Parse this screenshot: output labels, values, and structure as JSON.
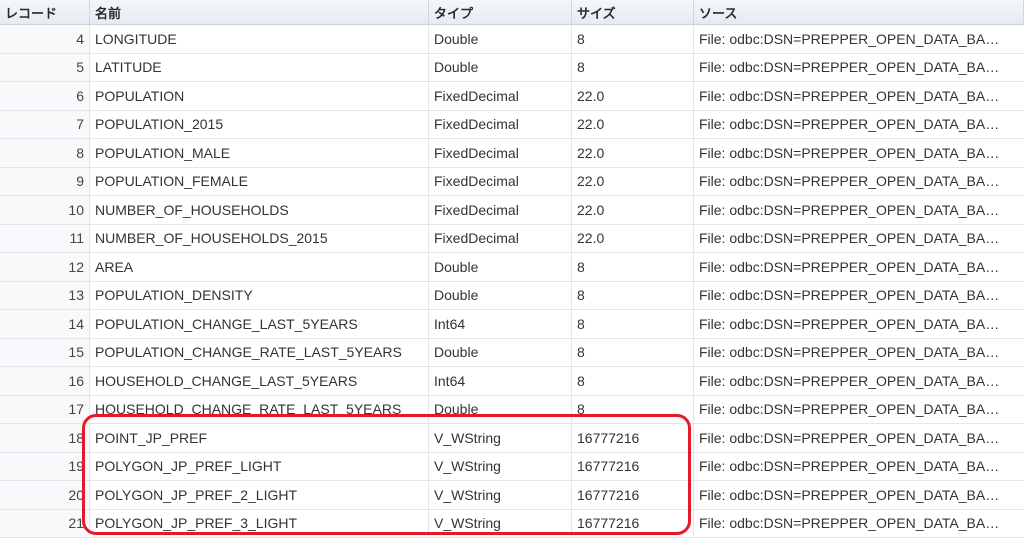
{
  "header": {
    "record": "レコード",
    "name": "名前",
    "type": "タイプ",
    "size": "サイズ",
    "source": "ソース"
  },
  "rows": [
    {
      "record": "4",
      "name": "LONGITUDE",
      "type": "Double",
      "size": "8",
      "source": "File:  odbc:DSN=PREPPER_OPEN_DATA_BA…"
    },
    {
      "record": "5",
      "name": "LATITUDE",
      "type": "Double",
      "size": "8",
      "source": "File:  odbc:DSN=PREPPER_OPEN_DATA_BA…"
    },
    {
      "record": "6",
      "name": "POPULATION",
      "type": "FixedDecimal",
      "size": "22.0",
      "source": "File:  odbc:DSN=PREPPER_OPEN_DATA_BA…"
    },
    {
      "record": "7",
      "name": "POPULATION_2015",
      "type": "FixedDecimal",
      "size": "22.0",
      "source": "File:  odbc:DSN=PREPPER_OPEN_DATA_BA…"
    },
    {
      "record": "8",
      "name": "POPULATION_MALE",
      "type": "FixedDecimal",
      "size": "22.0",
      "source": "File:  odbc:DSN=PREPPER_OPEN_DATA_BA…"
    },
    {
      "record": "9",
      "name": "POPULATION_FEMALE",
      "type": "FixedDecimal",
      "size": "22.0",
      "source": "File:  odbc:DSN=PREPPER_OPEN_DATA_BA…"
    },
    {
      "record": "10",
      "name": "NUMBER_OF_HOUSEHOLDS",
      "type": "FixedDecimal",
      "size": "22.0",
      "source": "File:  odbc:DSN=PREPPER_OPEN_DATA_BA…"
    },
    {
      "record": "11",
      "name": "NUMBER_OF_HOUSEHOLDS_2015",
      "type": "FixedDecimal",
      "size": "22.0",
      "source": "File:  odbc:DSN=PREPPER_OPEN_DATA_BA…"
    },
    {
      "record": "12",
      "name": "AREA",
      "type": "Double",
      "size": "8",
      "source": "File:  odbc:DSN=PREPPER_OPEN_DATA_BA…"
    },
    {
      "record": "13",
      "name": "POPULATION_DENSITY",
      "type": "Double",
      "size": "8",
      "source": "File:  odbc:DSN=PREPPER_OPEN_DATA_BA…"
    },
    {
      "record": "14",
      "name": "POPULATION_CHANGE_LAST_5YEARS",
      "type": "Int64",
      "size": "8",
      "source": "File:  odbc:DSN=PREPPER_OPEN_DATA_BA…"
    },
    {
      "record": "15",
      "name": "POPULATION_CHANGE_RATE_LAST_5YEARS",
      "type": "Double",
      "size": "8",
      "source": "File:  odbc:DSN=PREPPER_OPEN_DATA_BA…"
    },
    {
      "record": "16",
      "name": "HOUSEHOLD_CHANGE_LAST_5YEARS",
      "type": "Int64",
      "size": "8",
      "source": "File:  odbc:DSN=PREPPER_OPEN_DATA_BA…"
    },
    {
      "record": "17",
      "name": "HOUSEHOLD_CHANGE_RATE_LAST_5YEARS",
      "type": "Double",
      "size": "8",
      "source": "File:  odbc:DSN=PREPPER_OPEN_DATA_BA…"
    },
    {
      "record": "18",
      "name": "POINT_JP_PREF",
      "type": "V_WString",
      "size": "16777216",
      "source": "File: odbc:DSN=PREPPER_OPEN_DATA_BA…"
    },
    {
      "record": "19",
      "name": "POLYGON_JP_PREF_LIGHT",
      "type": "V_WString",
      "size": "16777216",
      "source": "File: odbc:DSN=PREPPER_OPEN_DATA_BA…"
    },
    {
      "record": "20",
      "name": "POLYGON_JP_PREF_2_LIGHT",
      "type": "V_WString",
      "size": "16777216",
      "source": "File: odbc:DSN=PREPPER_OPEN_DATA_BA…"
    },
    {
      "record": "21",
      "name": "POLYGON_JP_PREF_3_LIGHT",
      "type": "V_WString",
      "size": "16777216",
      "source": "File: odbc:DSN=PREPPER_OPEN_DATA_BA…"
    }
  ],
  "colors": {
    "highlight_border": "#e5192c"
  }
}
